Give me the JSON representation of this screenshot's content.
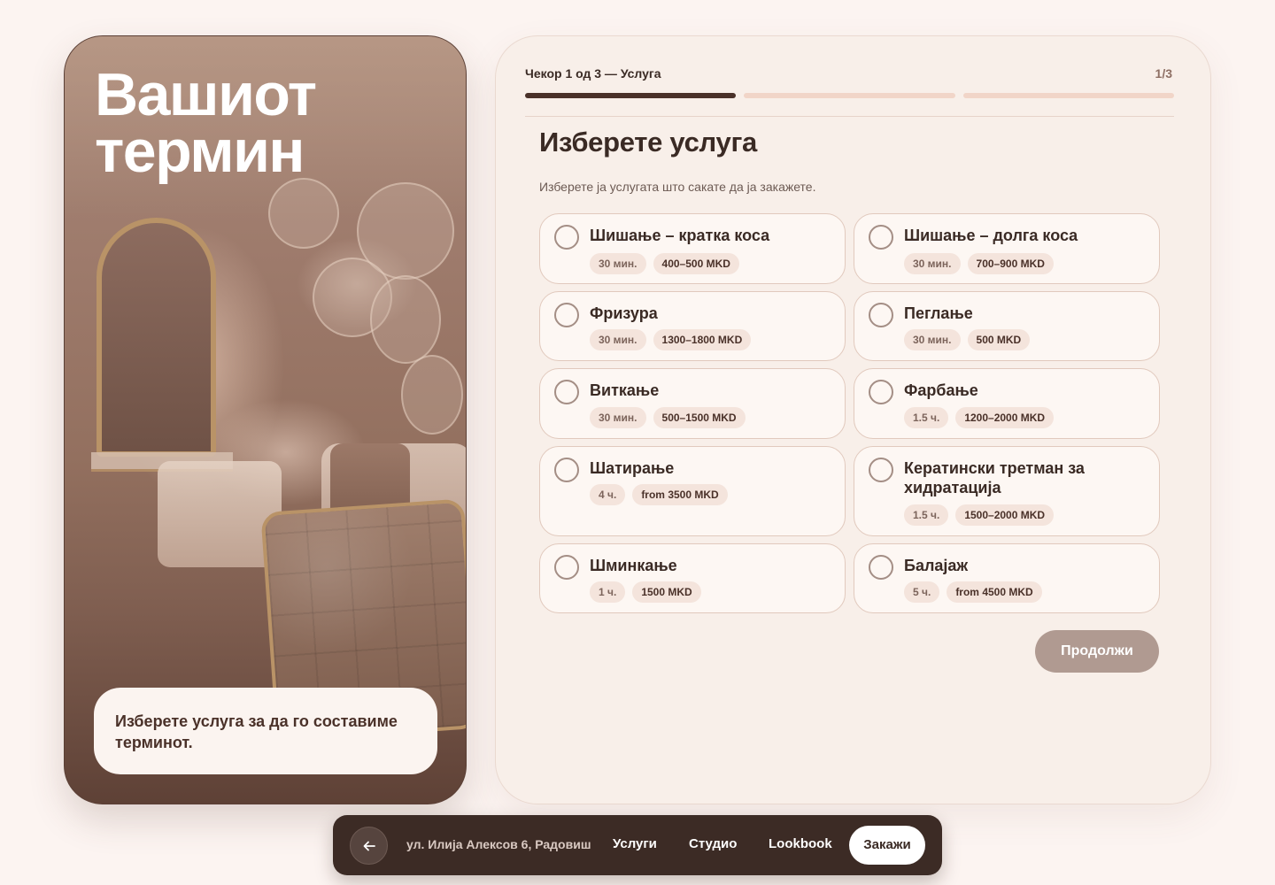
{
  "hero": {
    "title_line1": "Вашиот",
    "title_line2": "термин",
    "note": "Изберете услуга за да го составиме терминот."
  },
  "booking": {
    "step_label": "Чекор 1 од 3 — Услуга",
    "step_count": "1/3",
    "progress_active_step": 1,
    "progress_total_steps": 3,
    "title": "Изберете услуга",
    "subtitle": "Изберете ја услугата што сакате да ја закажете.",
    "services": [
      {
        "name": "Шишање – кратка коса",
        "duration": "30 мин.",
        "price": "400–500 MKD",
        "selected": false
      },
      {
        "name": "Шишање – долга коса",
        "duration": "30 мин.",
        "price": "700–900 MKD",
        "selected": false
      },
      {
        "name": "Фризура",
        "duration": "30 мин.",
        "price": "1300–1800 MKD",
        "selected": false
      },
      {
        "name": "Пеглање",
        "duration": "30 мин.",
        "price": "500 MKD",
        "selected": false
      },
      {
        "name": "Виткање",
        "duration": "30 мин.",
        "price": "500–1500 MKD",
        "selected": false
      },
      {
        "name": "Фарбање",
        "duration": "1.5 ч.",
        "price": "1200–2000 MKD",
        "selected": false
      },
      {
        "name": "Шатирање",
        "duration": "4 ч.",
        "price": "from 3500 MKD",
        "selected": false
      },
      {
        "name": "Кератински третман за хидратација",
        "duration": "1.5 ч.",
        "price": "1500–2000 MKD",
        "selected": false
      },
      {
        "name": "Шминкање",
        "duration": "1 ч.",
        "price": "1500 MKD",
        "selected": false
      },
      {
        "name": "Балајаж",
        "duration": "5 ч.",
        "price": "from 4500 MKD",
        "selected": false
      }
    ],
    "continue_label": "Продолжи"
  },
  "nav": {
    "back_icon": "arrow-left-icon",
    "address": "ул. Илија Алексов 6, Радовиш",
    "links": [
      "Услуги",
      "Студио",
      "Lookbook"
    ],
    "cta": "Закажи"
  },
  "colors": {
    "background": "#fcf4f1",
    "panel": "#f8efe9",
    "accent_dark": "#4a3129",
    "progress_inactive": "#f1d5c8",
    "button_disabled": "#b09a91",
    "nav_bg": "#3c2b25"
  }
}
